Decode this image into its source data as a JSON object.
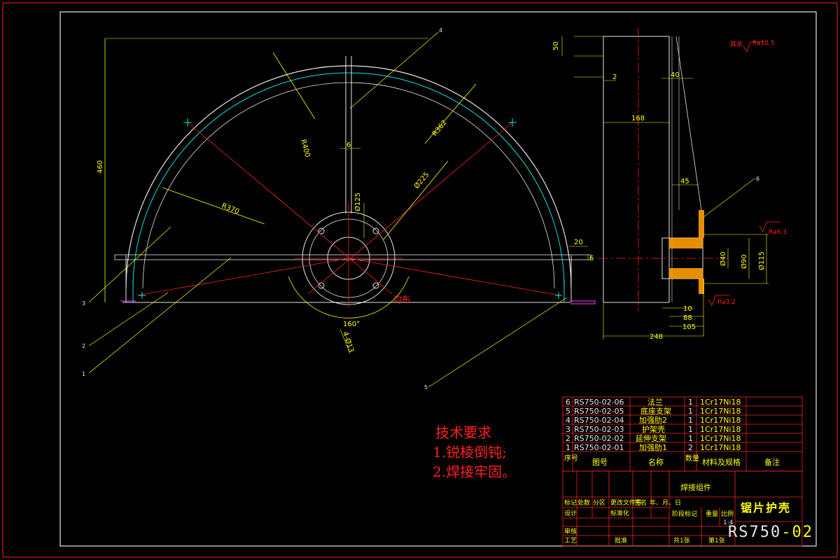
{
  "drawing": {
    "part_title": "锯片护壳",
    "assembly_name": "焊接组件",
    "drawing_number_main": "RS750",
    "drawing_number_suffix": "-02",
    "scale": "1:4",
    "roughness_note": "其余",
    "roughness_value": "Ra12.5"
  },
  "tech_requirements": {
    "heading": "技术要求",
    "items": [
      "1.锐棱倒钝;",
      "2.焊接牢固。"
    ]
  },
  "bom": {
    "header": {
      "seq": "序号",
      "code": "图号",
      "name": "名称",
      "qty": "数量",
      "material": "材料及规格",
      "note": "备注"
    },
    "rows": [
      {
        "seq": "6",
        "code": "RS750-02-06",
        "name": "法兰",
        "qty": "1",
        "material": "1Cr17Ni18"
      },
      {
        "seq": "5",
        "code": "RS750-02-05",
        "name": "底座支架",
        "qty": "1",
        "material": "1Cr17Ni18"
      },
      {
        "seq": "4",
        "code": "RS750-02-04",
        "name": "加强肋2",
        "qty": "1",
        "material": "1Cr17Ni18"
      },
      {
        "seq": "3",
        "code": "RS750-02-03",
        "name": "护架壳",
        "qty": "1",
        "material": "1Cr17Ni18"
      },
      {
        "seq": "2",
        "code": "RS750-02-02",
        "name": "延伸支架",
        "qty": "1",
        "material": "1Cr17Ni18"
      },
      {
        "seq": "1",
        "code": "RS750-02-01",
        "name": "加强肋1",
        "qty": "2",
        "material": "1Cr17Ni18"
      }
    ]
  },
  "title_block": {
    "row_labels": [
      "标记",
      "处数",
      "分区",
      "更改文件号",
      "签名",
      "年、月、日"
    ],
    "design": "设计",
    "standardize": "标准化",
    "stage_label": "阶段标记",
    "weight": "重量",
    "scale_label": "比例",
    "review": "审核",
    "process": "工艺",
    "approve": "批准",
    "sheets_total": "共1张",
    "sheet_no": "第1张"
  },
  "dimensions": {
    "r400": "R400",
    "r362": "R362",
    "r370": "R370",
    "d225": "Ø225",
    "d125": "Ø125",
    "holes": "4-Ø13",
    "angle": "160°",
    "h460": "460",
    "d6": "6",
    "d20": "20",
    "d50": "50",
    "d6b": "6",
    "w50": "50",
    "w2": "2",
    "w40": "40",
    "w168": "168",
    "w45": "45",
    "w10": "10",
    "w88": "88",
    "w105": "105",
    "w248": "248",
    "d40": "Ø40",
    "d90": "Ø90",
    "d115": "Ø115",
    "ra63": "Ra6.3",
    "ra32": "Ra3.2",
    "even": "均布"
  },
  "callouts": [
    "1",
    "2",
    "3",
    "4",
    "5",
    "6"
  ]
}
